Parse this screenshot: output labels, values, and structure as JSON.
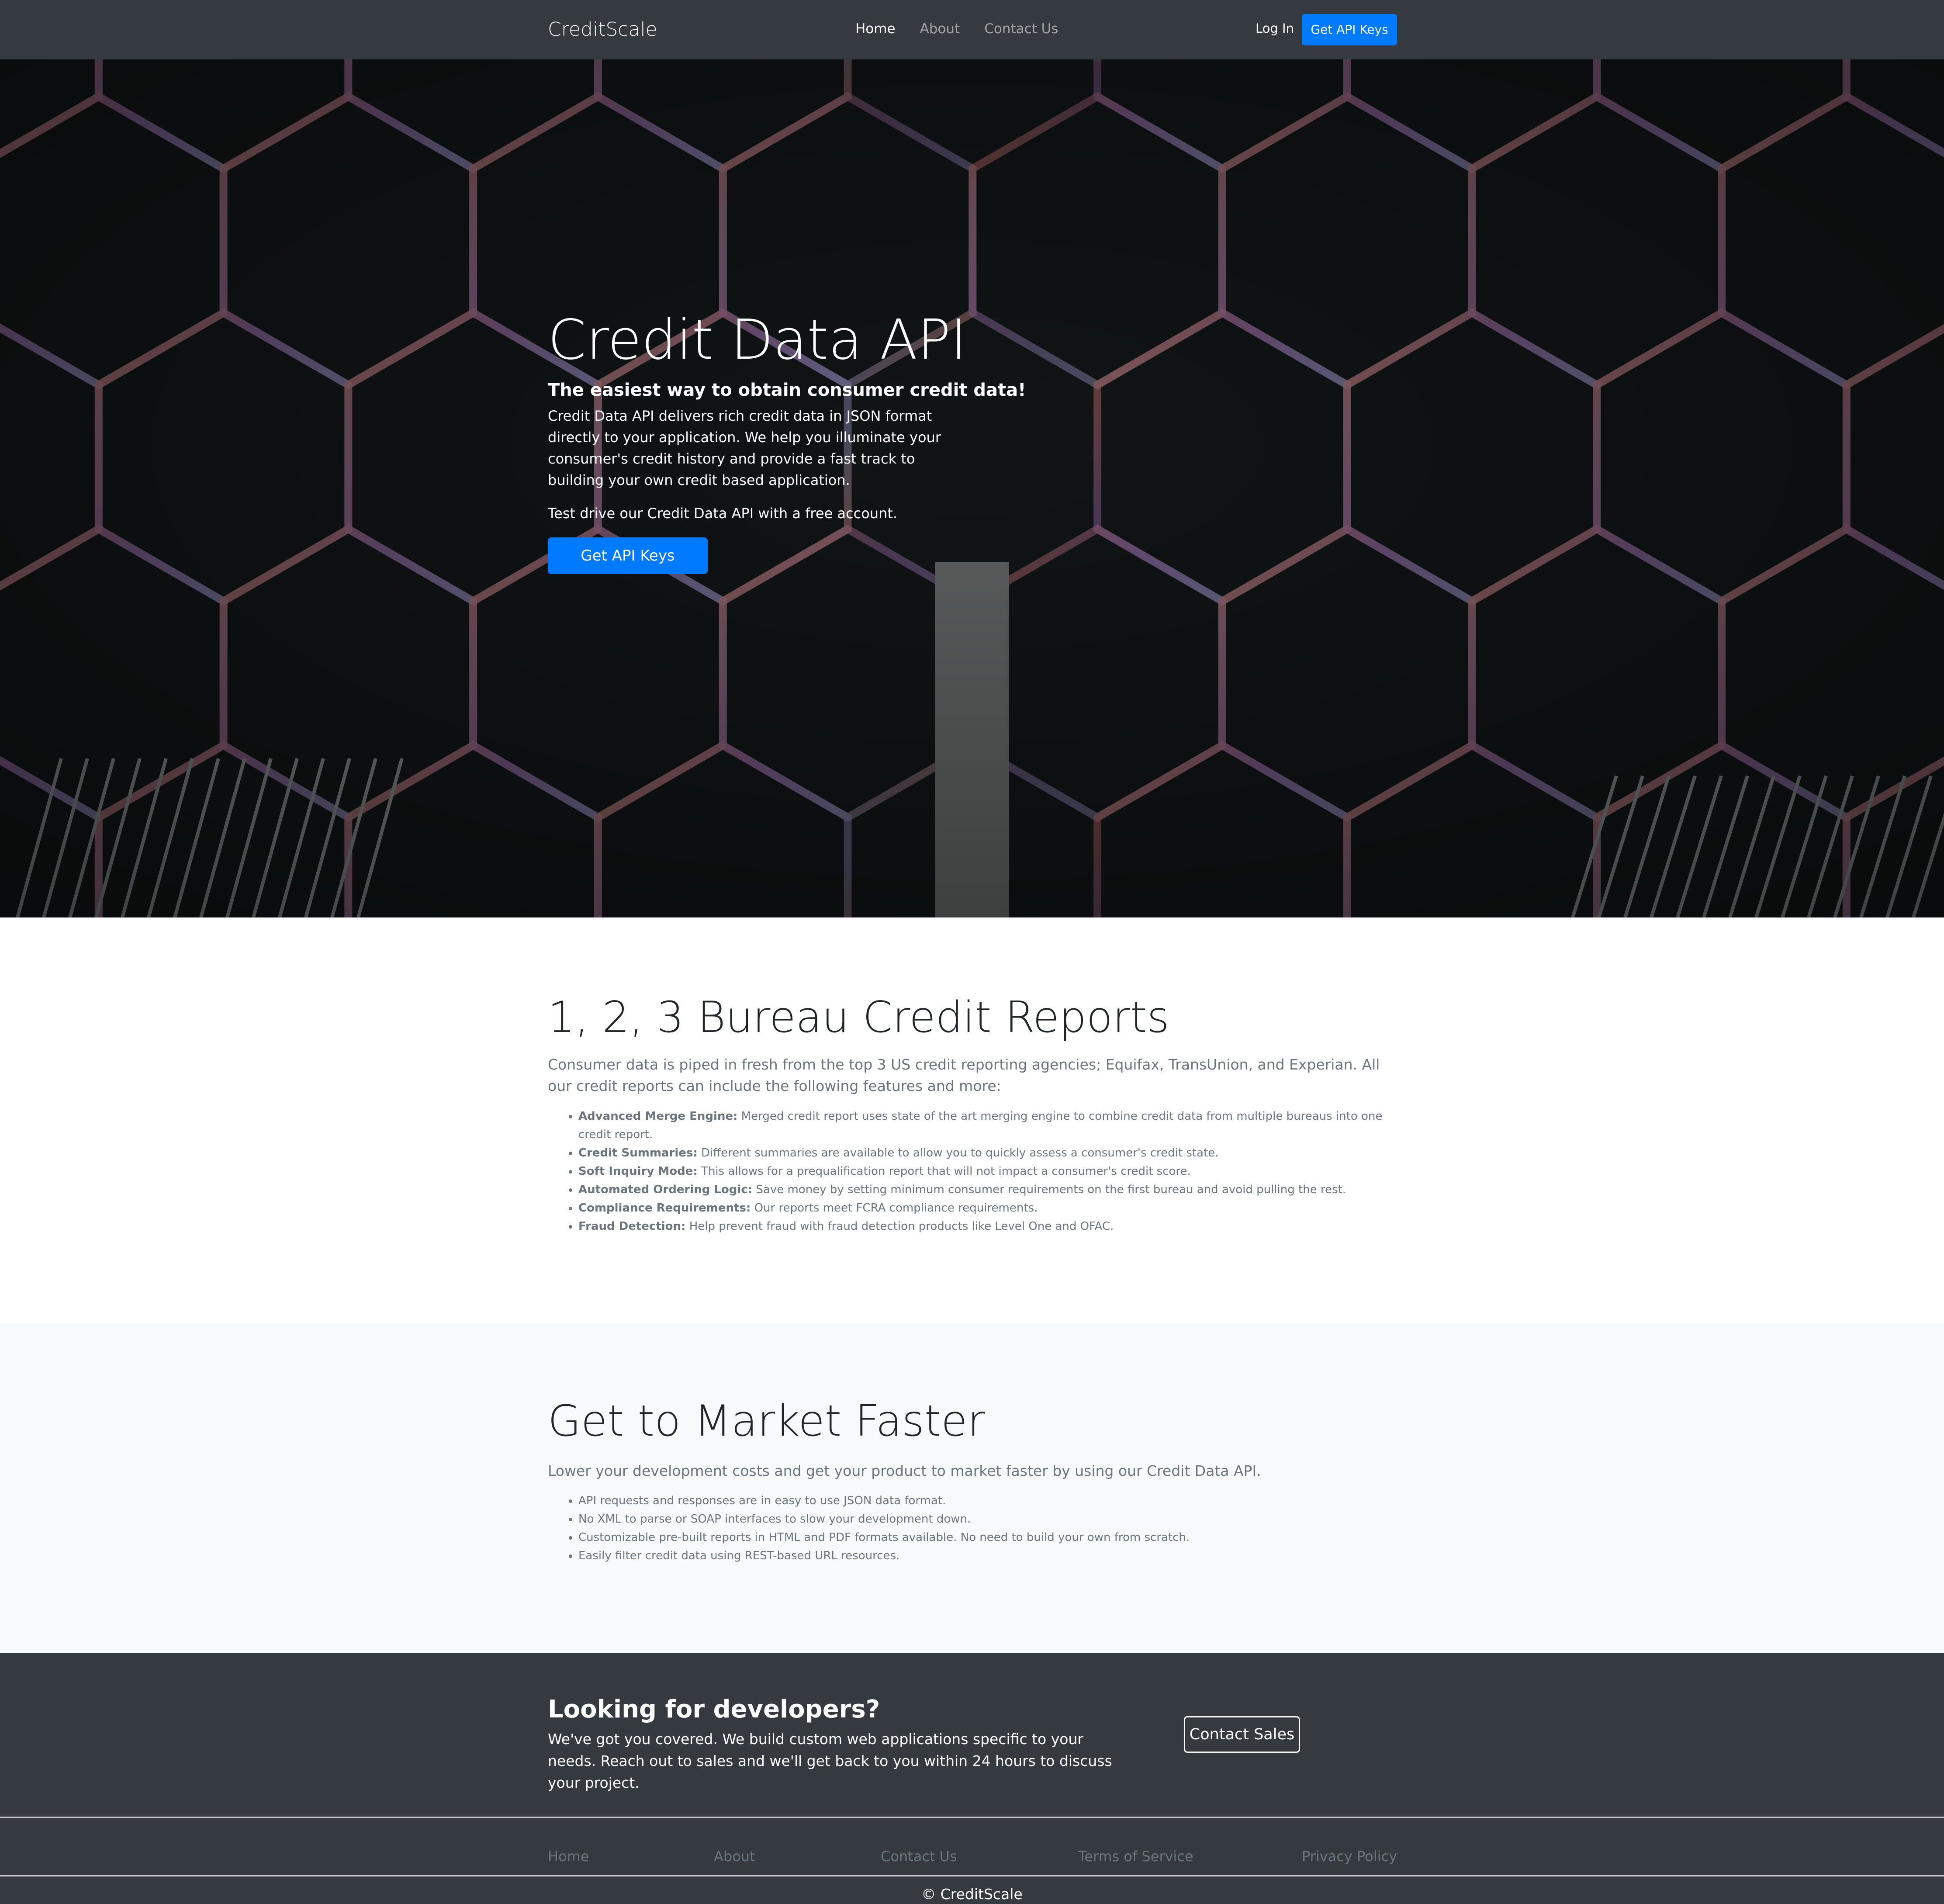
{
  "navbar": {
    "brand": "CreditScale",
    "links": [
      "Home",
      "About",
      "Contact Us"
    ],
    "login": "Log In",
    "cta": "Get API Keys"
  },
  "hero": {
    "title": "Credit Data API",
    "subtitle": "The easiest way to obtain consumer credit data!",
    "description": "Credit Data API delivers rich credit data in JSON format directly to your application. We help you illuminate your consumer's credit history and provide a fast track to building your own credit based application.",
    "description2": "Test drive our Credit Data API with a free account.",
    "button": "Get API Keys"
  },
  "reports": {
    "title": "1, 2, 3 Bureau Credit Reports",
    "lead": "Consumer data is piped in fresh from the top 3 US credit reporting agencies; Equifax, TransUnion, and Experian. All our credit reports can include the following features and more:",
    "features": [
      {
        "name": "Advanced Merge Engine:",
        "text": " Merged credit report uses state of the art merging engine to combine credit data from multiple bureaus into one credit report."
      },
      {
        "name": "Credit Summaries:",
        "text": " Different summaries are available to allow you to quickly assess a consumer's credit state."
      },
      {
        "name": "Soft Inquiry Mode:",
        "text": " This allows for a prequalification report that will not impact a consumer's credit score."
      },
      {
        "name": "Automated Ordering Logic:",
        "text": " Save money by setting minimum consumer requirements on the first bureau and avoid pulling the rest."
      },
      {
        "name": "Compliance Requirements:",
        "text": " Our reports meet FCRA compliance requirements."
      },
      {
        "name": "Fraud Detection:",
        "text": " Help prevent fraud with fraud detection products like Level One and OFAC."
      }
    ]
  },
  "market": {
    "title": "Get to Market Faster",
    "lead": "Lower your development costs and get your product to market faster by using our Credit Data API.",
    "items": [
      "API requests and responses are in easy to use JSON data format.",
      "No XML to parse or SOAP interfaces to slow your development down.",
      "Customizable pre-built reports in HTML and PDF formats available. No need to build your own from scratch.",
      "Easily filter credit data using REST-based URL resources."
    ]
  },
  "cta": {
    "title": "Looking for developers?",
    "text": "We've got you covered. We build custom web applications specific to your needs. Reach out to sales and we'll get back to you within 24 hours to discuss your project.",
    "button": "Contact Sales"
  },
  "footer": {
    "links": [
      "Home",
      "About",
      "Contact Us",
      "Terms of Service",
      "Privacy Policy"
    ],
    "copyright": "© CreditScale"
  },
  "colors": {
    "primary": "#007bff",
    "dark": "#343a40",
    "muted": "#6c757d",
    "light": "#f8f9fa",
    "hex_glow_purple": "#9a6aa6",
    "hex_glow_orange": "#e07a4a"
  }
}
